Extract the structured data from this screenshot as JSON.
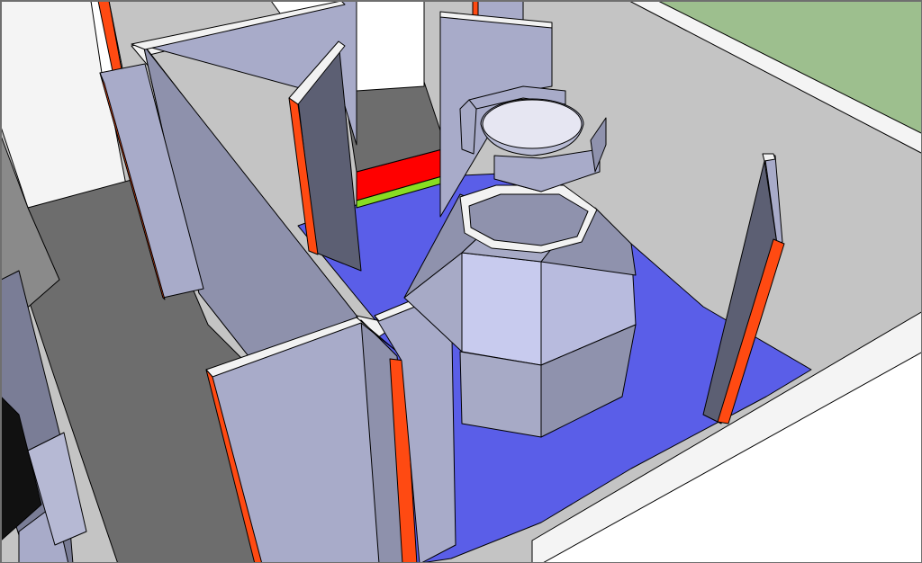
{
  "scene": {
    "description_visible_text": "",
    "colors": {
      "sky": "#ffffff",
      "ground_green": "#9dbf8e",
      "outer_floor_gray": "#c4c4c4",
      "inner_floor_dark": "#6b6b6b",
      "arena_floor_blue": "#5a5ee8",
      "wall_light": "#a8abc9",
      "wall_mid": "#8e91ac",
      "wall_dark": "#5c5f73",
      "wall_top": "#f2f2f2",
      "accent_orange": "#ff4a12",
      "accent_red": "#ff0000",
      "accent_green": "#88dd22",
      "tower_light": "#c8cbee",
      "tower_mid": "#a7aac6",
      "tower_dark": "#8f92ad",
      "bowl_inner": "#e6e6f2"
    }
  }
}
